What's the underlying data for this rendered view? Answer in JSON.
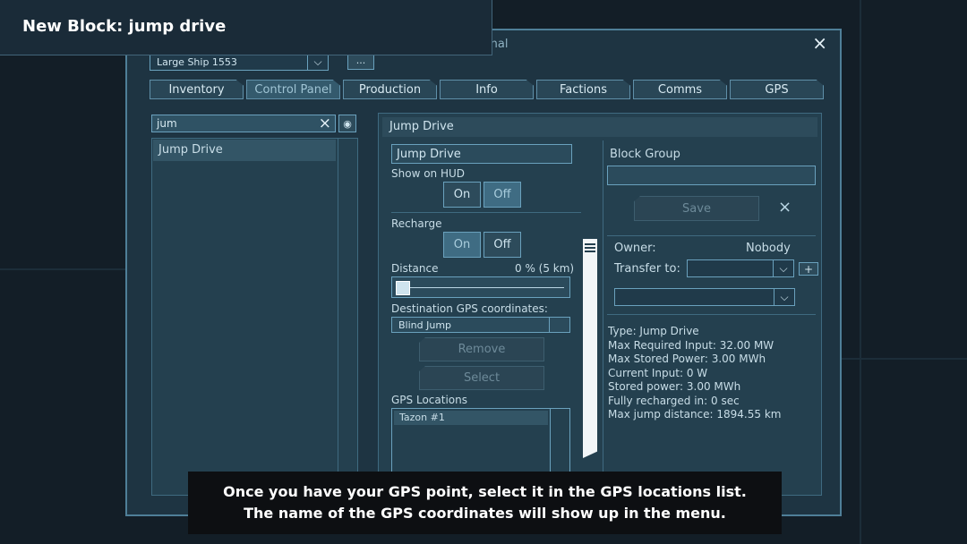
{
  "video": {
    "title": "New Block: jump drive",
    "subtitle_line1": "Once you have your GPS point, select it in the GPS locations list.",
    "subtitle_line2": "The name of the GPS coordinates will show up in the menu."
  },
  "window": {
    "title": "Terminal",
    "close": "×",
    "ship_select": "Large Ship 1553",
    "ellipsis": "..."
  },
  "tabs": [
    {
      "label": "Inventory"
    },
    {
      "label": "Control Panel"
    },
    {
      "label": "Production"
    },
    {
      "label": "Info"
    },
    {
      "label": "Factions"
    },
    {
      "label": "Comms"
    },
    {
      "label": "GPS"
    }
  ],
  "search": {
    "value": "jum",
    "clear": "×"
  },
  "block_list": {
    "items": [
      "Jump Drive"
    ]
  },
  "detail": {
    "header": "Jump Drive",
    "name_field": "Jump Drive",
    "show_on_hud": {
      "label": "Show on HUD",
      "on": "On",
      "off": "Off",
      "selected": "off"
    },
    "recharge": {
      "label": "Recharge",
      "on": "On",
      "off": "Off",
      "selected": "on"
    },
    "distance": {
      "label": "Distance",
      "value": "0 % (5 km)",
      "level": 0
    },
    "destination": {
      "label": "Destination GPS coordinates:",
      "value": "Blind Jump"
    },
    "remove": "Remove",
    "select": "Select",
    "gps_locations": {
      "label": "GPS Locations",
      "items": [
        "Tazon #1"
      ]
    },
    "block_group": {
      "label": "Block Group",
      "save": "Save",
      "clear": "×"
    },
    "owner": {
      "label": "Owner:",
      "value": "Nobody"
    },
    "transfer": {
      "label": "Transfer to:",
      "plus": "+"
    },
    "info": [
      "Type: Jump Drive",
      "Max Required Input: 32.00 MW",
      "Max Stored Power: 3.00 MWh",
      "Current Input: 0 W",
      "Stored power: 3.00 MWh",
      "Fully recharged in: 0 sec",
      "Max jump distance: 1894.55 km"
    ]
  }
}
